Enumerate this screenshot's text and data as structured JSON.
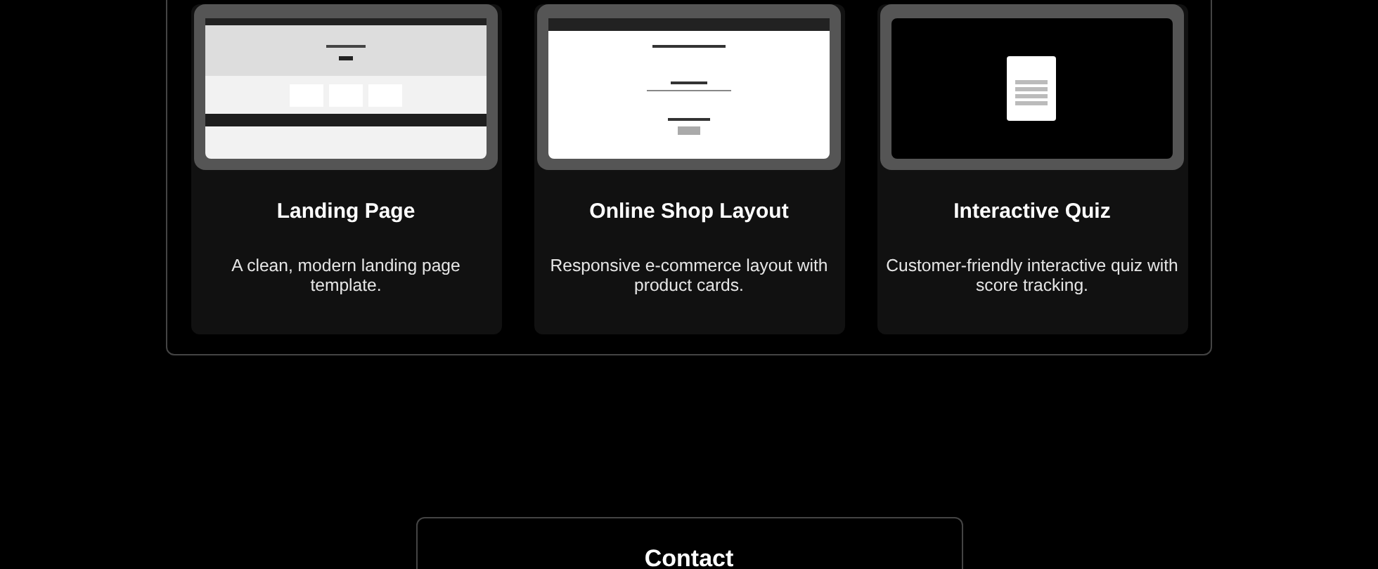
{
  "projects": [
    {
      "title": "Landing Page",
      "description": "A clean, modern landing page template."
    },
    {
      "title": "Online Shop Layout",
      "description": "Responsive e-commerce layout with product cards."
    },
    {
      "title": "Interactive Quiz",
      "description": "Customer-friendly interactive quiz with score tracking."
    }
  ],
  "contact": {
    "title": "Contact"
  }
}
